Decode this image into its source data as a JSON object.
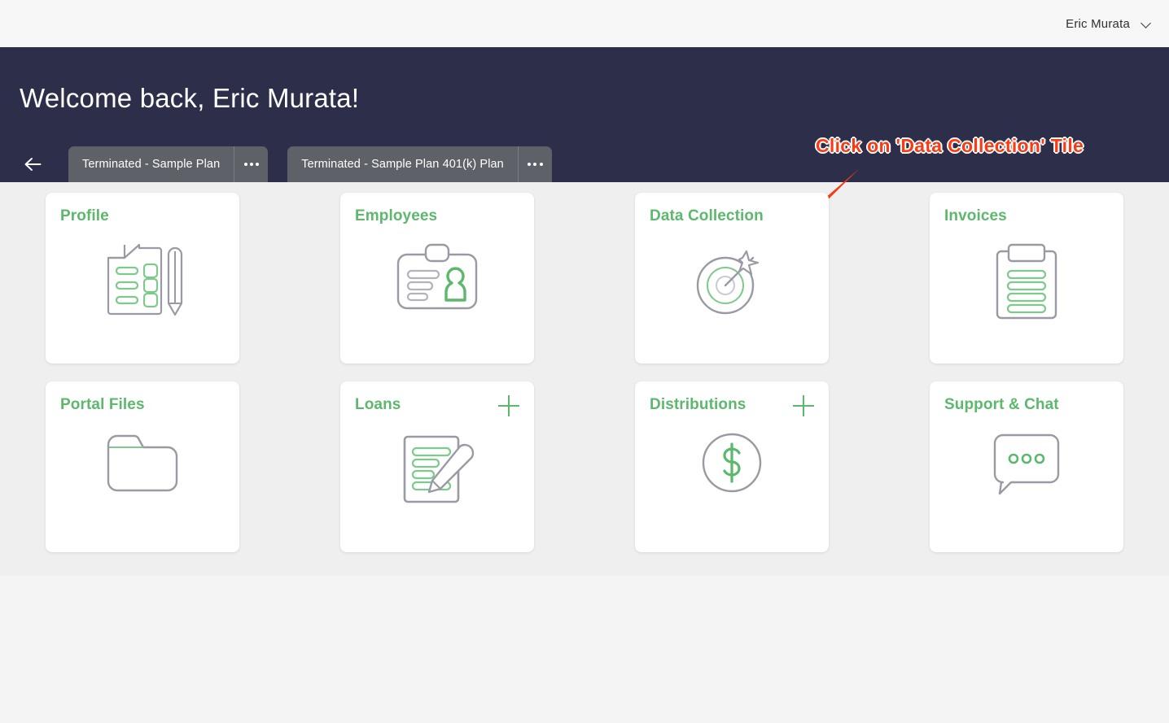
{
  "topbar": {
    "user_name": "Eric Murata",
    "chevron_icon": "chevron-down-icon"
  },
  "hero": {
    "welcome_text": "Welcome back, Eric Murata!",
    "annotation_text": "Click on 'Data Collection' Tile",
    "annotation_color": "#f93a12",
    "background_color": "#2d2e4a",
    "back_icon": "arrow-left-icon"
  },
  "tabs": [
    {
      "label": "Terminated - Sample Plan",
      "menu_icon": "ellipsis-icon"
    },
    {
      "label": "Terminated - Sample Plan 401(k) Plan",
      "menu_icon": "ellipsis-icon"
    }
  ],
  "theme": {
    "accent_green": "#5cb86c",
    "tile_background": "#ffffff",
    "area_background": "#efefef",
    "tab_background": "#5f6169"
  },
  "tiles": [
    [
      {
        "title": "Profile",
        "icon": "document-pencil-icon",
        "has_add": false
      },
      {
        "title": "Employees",
        "icon": "id-badge-person-icon",
        "has_add": false
      },
      {
        "title": "Data Collection",
        "icon": "target-arrow-icon",
        "has_add": false
      },
      {
        "title": "Invoices",
        "icon": "clipboard-lines-icon",
        "has_add": false
      }
    ],
    [
      {
        "title": "Portal Files",
        "icon": "folder-icon",
        "has_add": false
      },
      {
        "title": "Loans",
        "icon": "document-edit-icon",
        "has_add": true,
        "add_label": "+"
      },
      {
        "title": "Distributions",
        "icon": "dollar-circle-icon",
        "has_add": true,
        "add_label": "+"
      },
      {
        "title": "Support & Chat",
        "icon": "chat-bubble-icon",
        "has_add": false
      }
    ]
  ]
}
